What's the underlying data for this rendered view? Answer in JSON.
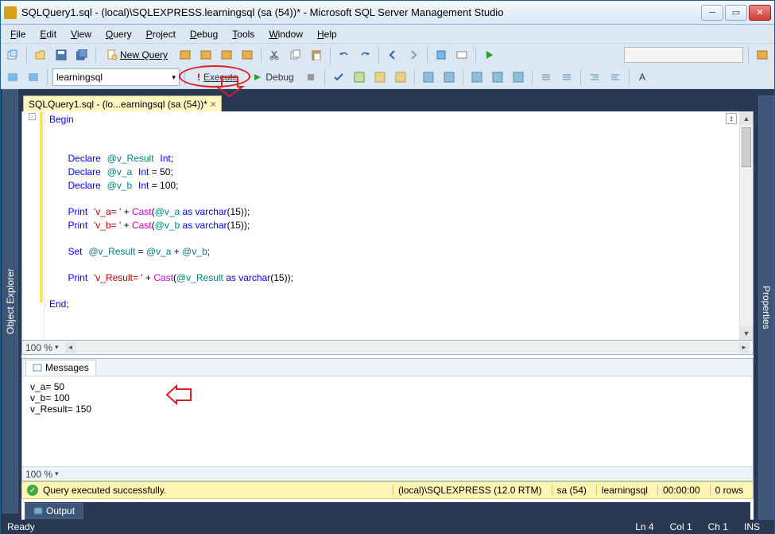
{
  "window": {
    "title": "SQLQuery1.sql - (local)\\SQLEXPRESS.learningsql (sa (54))* - Microsoft SQL Server Management Studio"
  },
  "menu": {
    "file": "File",
    "edit": "Edit",
    "view": "View",
    "query": "Query",
    "project": "Project",
    "debug": "Debug",
    "tools": "Tools",
    "window": "Window",
    "help": "Help"
  },
  "toolbar": {
    "new_query": "New Query",
    "database": "learningsql",
    "execute": "Execute",
    "debug": "Debug"
  },
  "sidebar": {
    "left": "Object Explorer",
    "right": "Properties"
  },
  "tab": {
    "label": "SQLQuery1.sql - (lo...earningsql (sa (54))*"
  },
  "code": {
    "l1a": "Begin",
    "l2a": "Declare",
    "l2b": "@v_Result",
    "l2c": "Int",
    "l2d": ";",
    "l3a": "Declare",
    "l3b": "@v_a",
    "l3c": "Int",
    "l3d": " = 50;",
    "l4a": "Declare",
    "l4b": "@v_b",
    "l4c": "Int",
    "l4d": " = 100;",
    "l5a": "Print",
    "l5b": "'v_a= '",
    "l5c": " + ",
    "l5d": "Cast",
    "l5e": "(",
    "l5f": "@v_a",
    "l5g": " as ",
    "l5h": "varchar",
    "l5i": "(15));",
    "l6a": "Print",
    "l6b": "'v_b= '",
    "l6c": " + ",
    "l6d": "Cast",
    "l6e": "(",
    "l6f": "@v_b",
    "l6g": " as ",
    "l6h": "varchar",
    "l6i": "(15));",
    "l7a": "Set",
    "l7b": "@v_Result",
    "l7c": " = ",
    "l7d": "@v_a",
    "l7e": " + ",
    "l7f": "@v_b",
    "l7g": ";",
    "l8a": "Print",
    "l8b": "'v_Result= '",
    "l8c": " + ",
    "l8d": "Cast",
    "l8e": "(",
    "l8f": "@v_Result",
    "l8g": " as ",
    "l8h": "varchar",
    "l8i": "(15));",
    "l9a": "End",
    "l9b": ";"
  },
  "zoom": {
    "code": "100 %",
    "msgs": "100 %"
  },
  "messages": {
    "tab": "Messages",
    "line1": "v_a= 50",
    "line2": "v_b= 100",
    "line3": "v_Result= 150"
  },
  "status_yellow": {
    "text": "Query executed successfully.",
    "server": "(local)\\SQLEXPRESS (12.0 RTM)",
    "user": "sa (54)",
    "db": "learningsql",
    "time": "00:00:00",
    "rows": "0 rows"
  },
  "output": {
    "label": "Output"
  },
  "bottom": {
    "ready": "Ready",
    "ln": "Ln 4",
    "col": "Col 1",
    "ch": "Ch 1",
    "ins": "INS"
  }
}
